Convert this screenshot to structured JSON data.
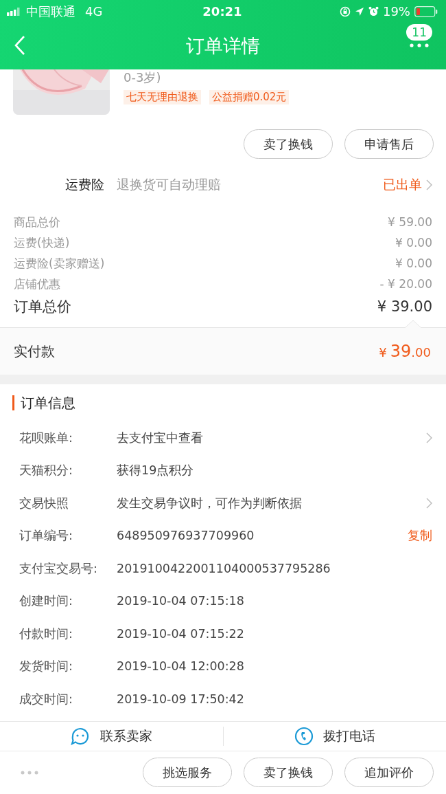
{
  "status_bar": {
    "carrier": "中国联通",
    "network": "4G",
    "time": "20:21",
    "battery": "19%"
  },
  "header": {
    "title": "订单详情",
    "badge": "11"
  },
  "product": {
    "image": {
      "kind": "picture"
    },
    "subtitle": "0-3岁)",
    "tags": [
      "七天无理由退换",
      "公益捐赠0.02元"
    ]
  },
  "product_actions": [
    "卖了换钱",
    "申请售后"
  ],
  "insurance": {
    "label": "运费险",
    "description": "退换货可自动理赔",
    "status": "已出单"
  },
  "price_rows": [
    {
      "label": "商品总价",
      "value": "¥ 59.00",
      "kind": "normal"
    },
    {
      "label": "运费(快递)",
      "value": "¥ 0.00",
      "kind": "normal"
    },
    {
      "label": "运费险(卖家赠送)",
      "value": "¥ 0.00",
      "kind": "normal"
    },
    {
      "label": "店铺优惠",
      "value": "- ¥ 20.00",
      "kind": "normal"
    },
    {
      "label": "订单总价",
      "value": "¥ 39.00",
      "kind": "total"
    }
  ],
  "paid": {
    "label": "实付款",
    "currency": "¥",
    "integer": "39",
    "decimal": ".00"
  },
  "order_info": {
    "title": "订单信息",
    "rows": [
      {
        "label": "花呗账单:",
        "value": "去支付宝中查看",
        "has_chevron": true
      },
      {
        "label": "天猫积分:",
        "value": "获得19点积分"
      },
      {
        "label": "交易快照",
        "value": "发生交易争议时，可作为判断依据",
        "has_chevron": true
      },
      {
        "label": "订单编号:",
        "value": "648950976937709960",
        "copy_link": "复制"
      },
      {
        "label": "支付宝交易号:",
        "value": "2019100422001104000537795286"
      },
      {
        "label": "创建时间:",
        "value": "2019-10-04 07:15:18"
      },
      {
        "label": "付款时间:",
        "value": "2019-10-04 07:15:22"
      },
      {
        "label": "发货时间:",
        "value": "2019-10-04 12:00:28"
      },
      {
        "label": "成交时间:",
        "value": "2019-10-09 17:50:42"
      }
    ]
  },
  "contact": [
    {
      "label": "联系卖家",
      "kind": "chat"
    },
    {
      "label": "拨打电话",
      "kind": "phone"
    }
  ],
  "footer": {
    "buttons": [
      "挑选服务",
      "卖了换钱",
      "追加评价"
    ]
  }
}
